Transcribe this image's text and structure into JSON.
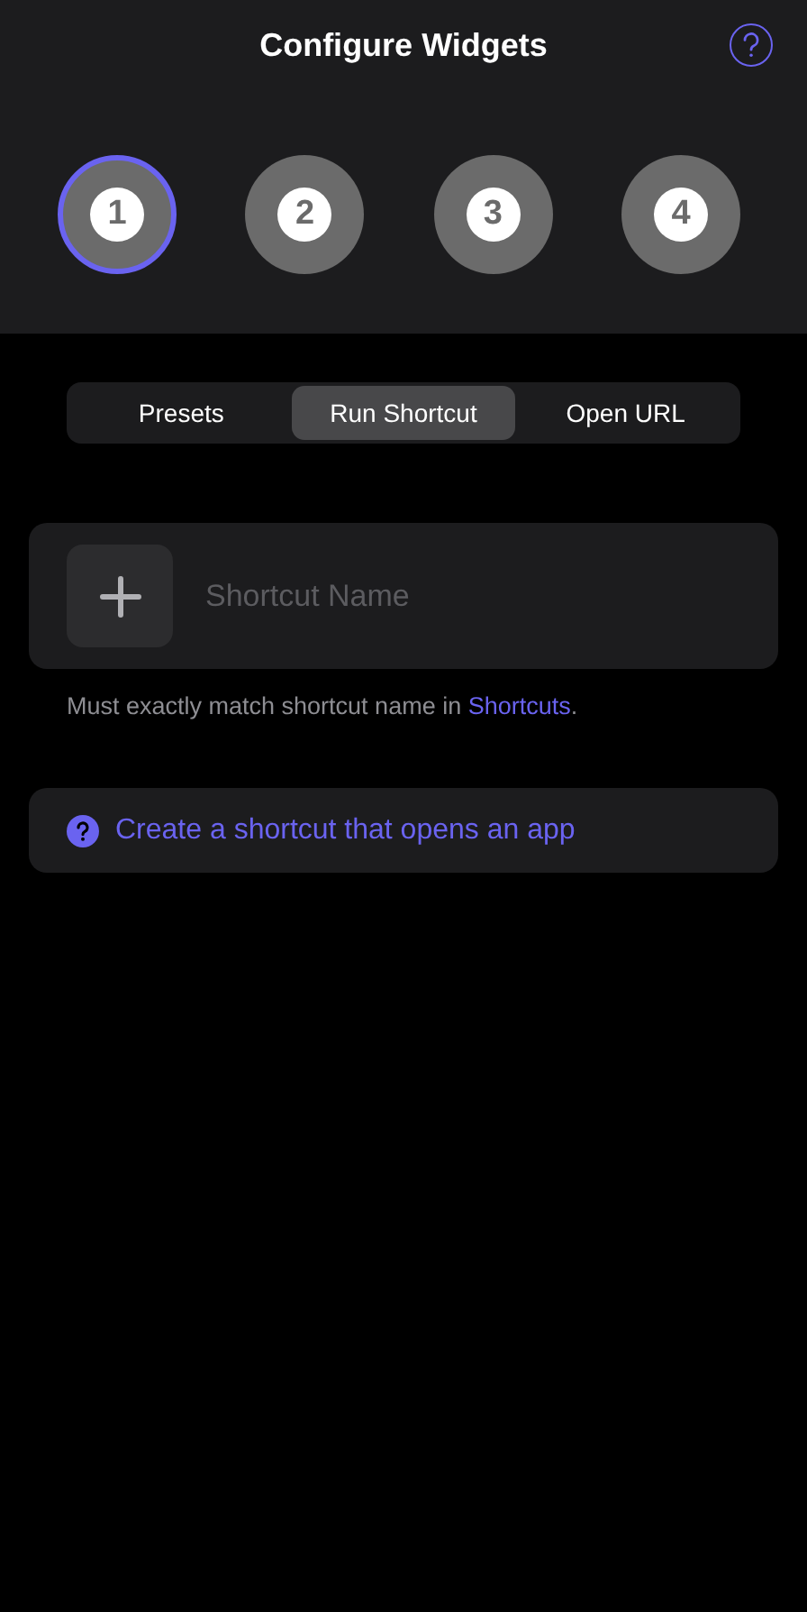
{
  "header": {
    "title": "Configure Widgets"
  },
  "steps": [
    {
      "label": "1",
      "selected": true
    },
    {
      "label": "2",
      "selected": false
    },
    {
      "label": "3",
      "selected": false
    },
    {
      "label": "4",
      "selected": false
    }
  ],
  "segments": [
    {
      "label": "Presets",
      "selected": false
    },
    {
      "label": "Run Shortcut",
      "selected": true
    },
    {
      "label": "Open URL",
      "selected": false
    }
  ],
  "shortcut_field": {
    "placeholder": "Shortcut Name"
  },
  "hint": {
    "text": "Must exactly match shortcut name in ",
    "link": "Shortcuts",
    "suffix": "."
  },
  "help_link": {
    "label": "Create a shortcut that opens an app"
  }
}
